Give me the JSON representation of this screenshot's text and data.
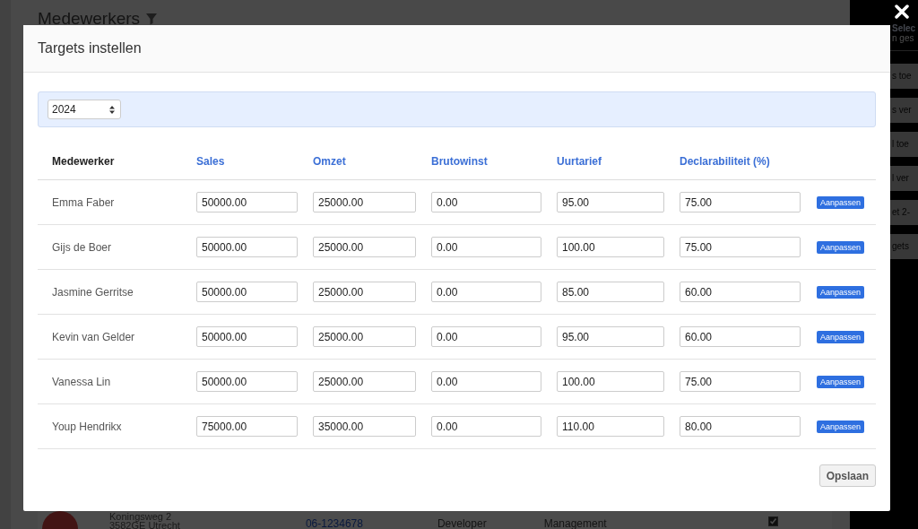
{
  "page": {
    "title": "Medewerkers",
    "side_panel": {
      "items": [
        "Selec",
        "n ges",
        "s toe",
        "s ver",
        "l toe",
        "l ver",
        "et 2-",
        "gets"
      ]
    },
    "visible_row": {
      "address": "Koningsweg 2",
      "city": "3582GE Utrecht",
      "phone": "06-1234678",
      "role": "Developer",
      "department": "Management",
      "checked": true
    }
  },
  "modal": {
    "title": "Targets instellen",
    "year": "2024",
    "columns": [
      {
        "label": "Medewerker",
        "sortable": false
      },
      {
        "label": "Sales",
        "sortable": true
      },
      {
        "label": "Omzet",
        "sortable": true
      },
      {
        "label": "Brutowinst",
        "sortable": true
      },
      {
        "label": "Uurtarief",
        "sortable": true
      },
      {
        "label": "Declarabiliteit (%)",
        "sortable": true
      }
    ],
    "rows": [
      {
        "name": "Emma Faber",
        "values": [
          "50000.00",
          "25000.00",
          "0.00",
          "95.00",
          "75.00"
        ],
        "action": "Aanpassen"
      },
      {
        "name": "Gijs de Boer",
        "values": [
          "50000.00",
          "25000.00",
          "0.00",
          "100.00",
          "75.00"
        ],
        "action": "Aanpassen"
      },
      {
        "name": "Jasmine Gerritse",
        "values": [
          "50000.00",
          "25000.00",
          "0.00",
          "85.00",
          "60.00"
        ],
        "action": "Aanpassen"
      },
      {
        "name": "Kevin van Gelder",
        "values": [
          "50000.00",
          "25000.00",
          "0.00",
          "95.00",
          "60.00"
        ],
        "action": "Aanpassen"
      },
      {
        "name": "Vanessa Lin",
        "values": [
          "50000.00",
          "25000.00",
          "0.00",
          "100.00",
          "75.00"
        ],
        "action": "Aanpassen"
      },
      {
        "name": "Youp Hendrikx",
        "values": [
          "75000.00",
          "35000.00",
          "0.00",
          "110.00",
          "80.00"
        ],
        "action": "Aanpassen"
      }
    ],
    "save_button": "Opslaan"
  }
}
